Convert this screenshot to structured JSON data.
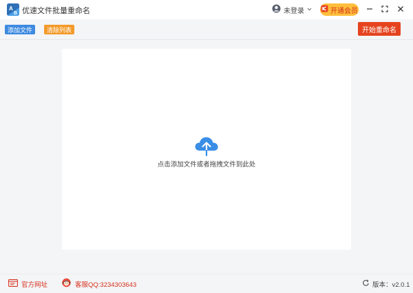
{
  "app": {
    "title": "优速文件批量重命名",
    "logo_text": "AB"
  },
  "header": {
    "user_label": "未登录",
    "vip_label": "开通会员"
  },
  "toolbar": {
    "add_files": "添加文件",
    "clear_list": "清除列表",
    "start_rename": "开始重命名"
  },
  "dropzone": {
    "hint": "点击添加文件或者拖拽文件到此处"
  },
  "footer": {
    "website": "官方网址",
    "support": "客服QQ:3234303643",
    "version": "版本：v2.0.1"
  },
  "colors": {
    "accent_blue": "#3d8ae0",
    "accent_orange": "#f39a2a",
    "primary_red": "#e5431f",
    "vip_gold": "#ffbf3c"
  },
  "icons": {
    "logo": "app-logo-icon",
    "user": "user-icon",
    "dropdown": "chevron-down-icon",
    "vip": "vip-icon",
    "minimize": "minimize-icon",
    "maximize": "maximize-icon",
    "close": "close-icon",
    "upload": "cloud-upload-icon",
    "website": "browser-icon",
    "support": "customer-service-icon",
    "version": "refresh-icon"
  }
}
